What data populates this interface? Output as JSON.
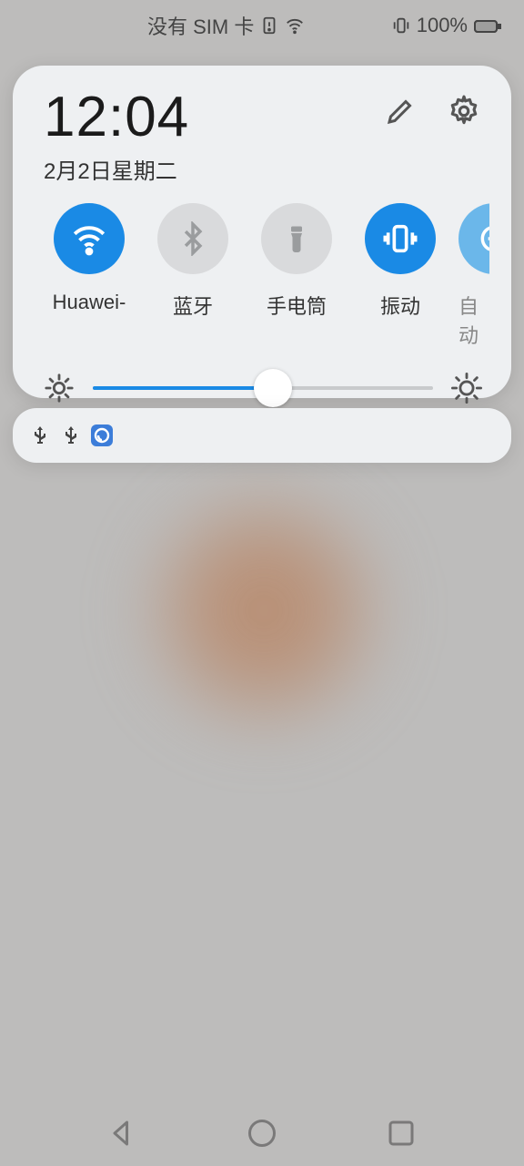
{
  "statusbar": {
    "sim_text": "没有 SIM 卡",
    "battery_pct": "100%"
  },
  "panel": {
    "time": "12:04",
    "date": "2月2日星期二"
  },
  "toggles": [
    {
      "label": "Huawei-",
      "active": true
    },
    {
      "label": "蓝牙",
      "active": false
    },
    {
      "label": "手电筒",
      "active": false
    },
    {
      "label": "振动",
      "active": true
    },
    {
      "label": "自动",
      "active": true
    }
  ],
  "brightness": {
    "percent": 53
  },
  "colors": {
    "accent": "#1a8ae5"
  }
}
